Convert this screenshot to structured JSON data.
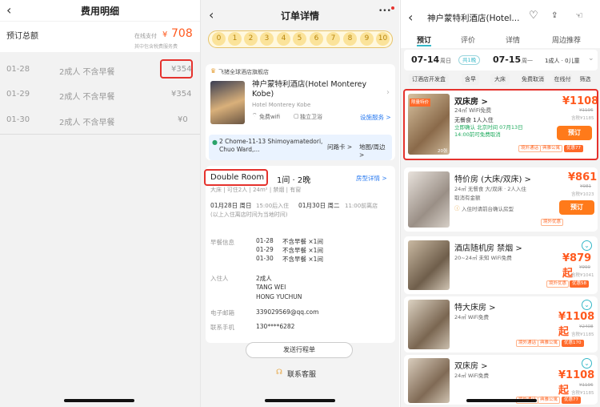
{
  "cost": {
    "title": "费用明细",
    "total_label": "预订总额",
    "online_pay": "在线支付",
    "currency": "¥",
    "amount": "708",
    "tax_note": "其中包含税费服务费",
    "rows": [
      {
        "date": "01-28",
        "desc": "2成人 不含早餐",
        "price": "¥354"
      },
      {
        "date": "01-29",
        "desc": "2成人 不含早餐",
        "price": "¥354"
      },
      {
        "date": "01-30",
        "desc": "2成人 不含早餐",
        "price": "¥0"
      }
    ]
  },
  "order": {
    "title": "订单详情",
    "more": "•••",
    "steps": [
      "0",
      "1",
      "2",
      "3",
      "4",
      "5",
      "6",
      "7",
      "8",
      "9",
      "10"
    ],
    "store": "飞猪全球酒店旗舰店",
    "hotel_name": "神户蒙特利酒店(Hotel Monterey Kobe)",
    "hotel_en": "Hotel Monterey Kobe",
    "wifi": "免费wifi",
    "bath": "独立卫浴",
    "facility_link": "设施服务 >",
    "address": "2 Chome-11-13 Shimoyamatedori, Chuo Ward,...",
    "ask_card": "问路卡 >",
    "map_link": "地图/周边 >",
    "room_type": "Double Room",
    "room_qty": "1间 · 2晚",
    "room_detail_link": "房型详情 >",
    "room_meta": "大床 | 可住2人 | 24m² | 禁烟 | 有窗",
    "checkin": "01月28日 周日",
    "checkin_time": "15:00后入住",
    "checkout": "01月30日 周二",
    "checkout_time": "11:00前离店",
    "time_note": "(以上入住离店时间为当地时间)",
    "breakfast_label": "早餐信息",
    "breakfast": [
      {
        "date": "01-28",
        "val": "不含早餐 ×1间"
      },
      {
        "date": "01-29",
        "val": "不含早餐 ×1间"
      },
      {
        "date": "01-30",
        "val": "不含早餐 ×1间"
      }
    ],
    "guest_label": "入住人",
    "guest_count": "2成人",
    "guests": [
      "TANG WEI",
      "HONG YUCHUN"
    ],
    "email_label": "电子邮箱",
    "email": "339029569@qq.com",
    "phone_label": "联系手机",
    "phone": "130****6282",
    "send_btn": "发送行程单",
    "service": "联系客服"
  },
  "hotel": {
    "title": "神户蒙特利酒店(Hotel...",
    "tabs": [
      "预订",
      "评价",
      "详情",
      "周边推荐"
    ],
    "checkin": "07-14",
    "checkin_suffix": "周日",
    "nights": "共1晚",
    "checkout": "07-15",
    "checkout_suffix": "周一",
    "guests": "1成人 · 0儿童",
    "filters": [
      "订酒店开发盒",
      "含早",
      "大床",
      "免费取消",
      "在线付",
      "筛选"
    ],
    "rooms": [
      {
        "name": "双床房 >",
        "size": "24㎡ WiFi免费",
        "breakfast": "无餐食  1人入住",
        "confirm": "立即确认 北京时间 07月13日 14:00前可免费取消",
        "price": "¥1108",
        "orig": "¥1196",
        "tax": "含税¥1185",
        "book": "预订",
        "tags": [
          "境外通话",
          "典雅公寓",
          "优惠77"
        ],
        "badge": "限量特价",
        "count": "20张"
      },
      {
        "name": "特价房 (大床/双床) >",
        "size": "24㎡  无餐食  大/双床 · 2人入住",
        "extra": "取消有金额",
        "note": "入住时请前台确认房型",
        "price": "¥861",
        "orig": "¥981",
        "tax": "含税¥1023",
        "book": "预订",
        "tags": [
          "境外优惠"
        ]
      },
      {
        "name": "酒店随机房 禁烟 >",
        "size": "20~24㎡ 未知 WiFi免费",
        "price": "¥879起",
        "orig": "¥999",
        "tax": "含税¥1041",
        "tags": [
          "境外优惠",
          "优惠58"
        ]
      },
      {
        "name": "特大床房 >",
        "size": "24㎡ WiFi免费",
        "price": "¥1108起",
        "orig": "¥2408",
        "tax": "含税¥1185",
        "tags": [
          "境外通话",
          "典雅公寓",
          "优惠170"
        ]
      },
      {
        "name": "双床房 >",
        "size": "24㎡ WiFi免费",
        "price": "¥1108起",
        "orig": "¥1196",
        "tax": "含税¥1185",
        "tags": [
          "境外通话",
          "典雅公寓",
          "优惠77"
        ]
      }
    ]
  },
  "colors": {
    "accent": "#ff5a1f",
    "highlight": "#e5322d",
    "blue": "#2b7bf0",
    "teal": "#36b8c8"
  }
}
